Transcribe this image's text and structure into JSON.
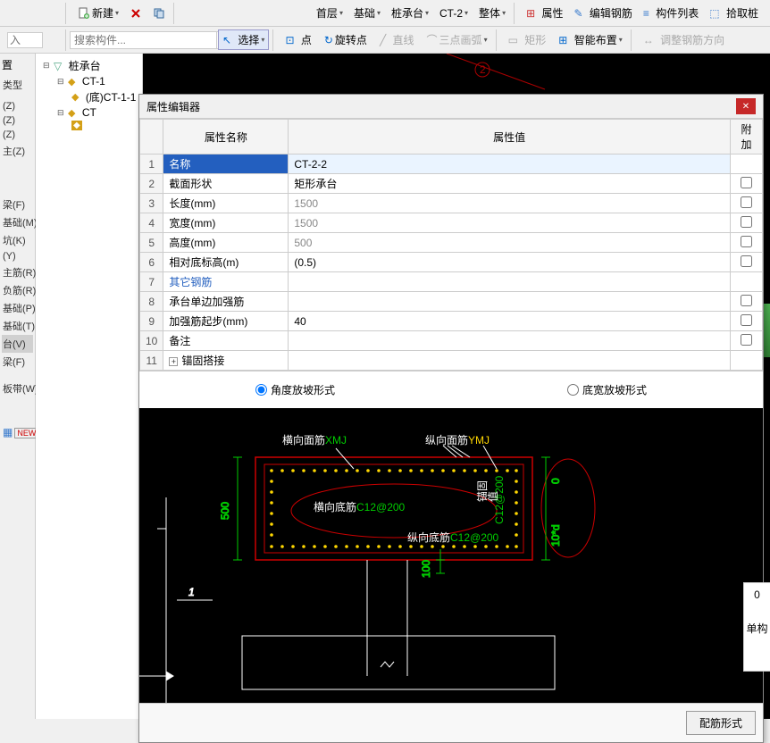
{
  "topbar": {
    "new": "新建",
    "nav": {
      "floor": "首层",
      "basic": "基础",
      "pile": "桩承台",
      "ct": "CT-2",
      "whole": "整体"
    },
    "props": "属性",
    "editrebar": "编辑钢筋",
    "elemlist": "构件列表",
    "pickpile": "拾取桩"
  },
  "toolbar2": {
    "input_placeholder": "入",
    "select": "选择",
    "point": "点",
    "rotatepoint": "旋转点",
    "line": "直线",
    "arc": "三点画弧",
    "rect": "矩形",
    "smart": "智能布置",
    "adjust": "调整钢筋方向"
  },
  "leftcol": {
    "heading": "置",
    "type": "类型",
    "items": [
      "(Z)",
      "(Z)",
      "(Z)",
      "主(Z)",
      "",
      "",
      "",
      "梁(F)",
      "基础(M)",
      "坑(K)",
      "(Y)",
      "主筋(R)",
      "负筋(R)",
      "基础(P)",
      "基础(T)",
      "台(V)",
      "梁(F)",
      "",
      "板带(W)"
    ]
  },
  "search": {
    "placeholder": "搜索构件..."
  },
  "tree": {
    "root": "桩承台",
    "ct1": "CT-1",
    "ct1_child": "(底)CT-1-1",
    "ct2": "CT"
  },
  "dialog": {
    "title": "属性编辑器",
    "cols": {
      "name": "属性名称",
      "value": "属性值",
      "att": "附加"
    },
    "rows": [
      {
        "n": "1",
        "name": "名称",
        "value": "CT-2-2",
        "sel": true
      },
      {
        "n": "2",
        "name": "截面形状",
        "value": "矩形承台",
        "chk": true
      },
      {
        "n": "3",
        "name": "长度(mm)",
        "value": "1500",
        "gray": true,
        "chk": true
      },
      {
        "n": "4",
        "name": "宽度(mm)",
        "value": "1500",
        "gray": true,
        "chk": true
      },
      {
        "n": "5",
        "name": "高度(mm)",
        "value": "500",
        "gray": true,
        "chk": true
      },
      {
        "n": "6",
        "name": "相对底标高(m)",
        "value": "(0.5)",
        "chk": true
      },
      {
        "n": "7",
        "name": "其它钢筋",
        "value": "",
        "blue": true
      },
      {
        "n": "8",
        "name": "承台单边加强筋",
        "value": "",
        "chk": true
      },
      {
        "n": "9",
        "name": "加强筋起步(mm)",
        "value": "40",
        "chk": true
      },
      {
        "n": "10",
        "name": "备注",
        "value": "",
        "chk": true
      },
      {
        "n": "11",
        "name": "锚固搭接",
        "value": "",
        "exp": true
      }
    ],
    "radio1": "角度放坡形式",
    "radio2": "底宽放坡形式",
    "footer_btn": "配筋形式"
  },
  "preview": {
    "top_h_label": "横向面筋",
    "top_h_code": "XMJ",
    "top_v_label": "纵向面筋",
    "top_v_code": "YMJ",
    "bot_h_label": "横向底筋",
    "bot_h_code": "C12@200",
    "bot_v_label": "纵向底筋",
    "bot_v_code": "C12@200",
    "side_code": "C12@200",
    "anchor1": "锚固",
    "anchor2": "值",
    "h_dim": "500",
    "v_dim": "100",
    "r_dim1": "0",
    "r_dim2": "10*d",
    "one": "1"
  },
  "side": {
    "zero": "0",
    "single": "单构"
  }
}
